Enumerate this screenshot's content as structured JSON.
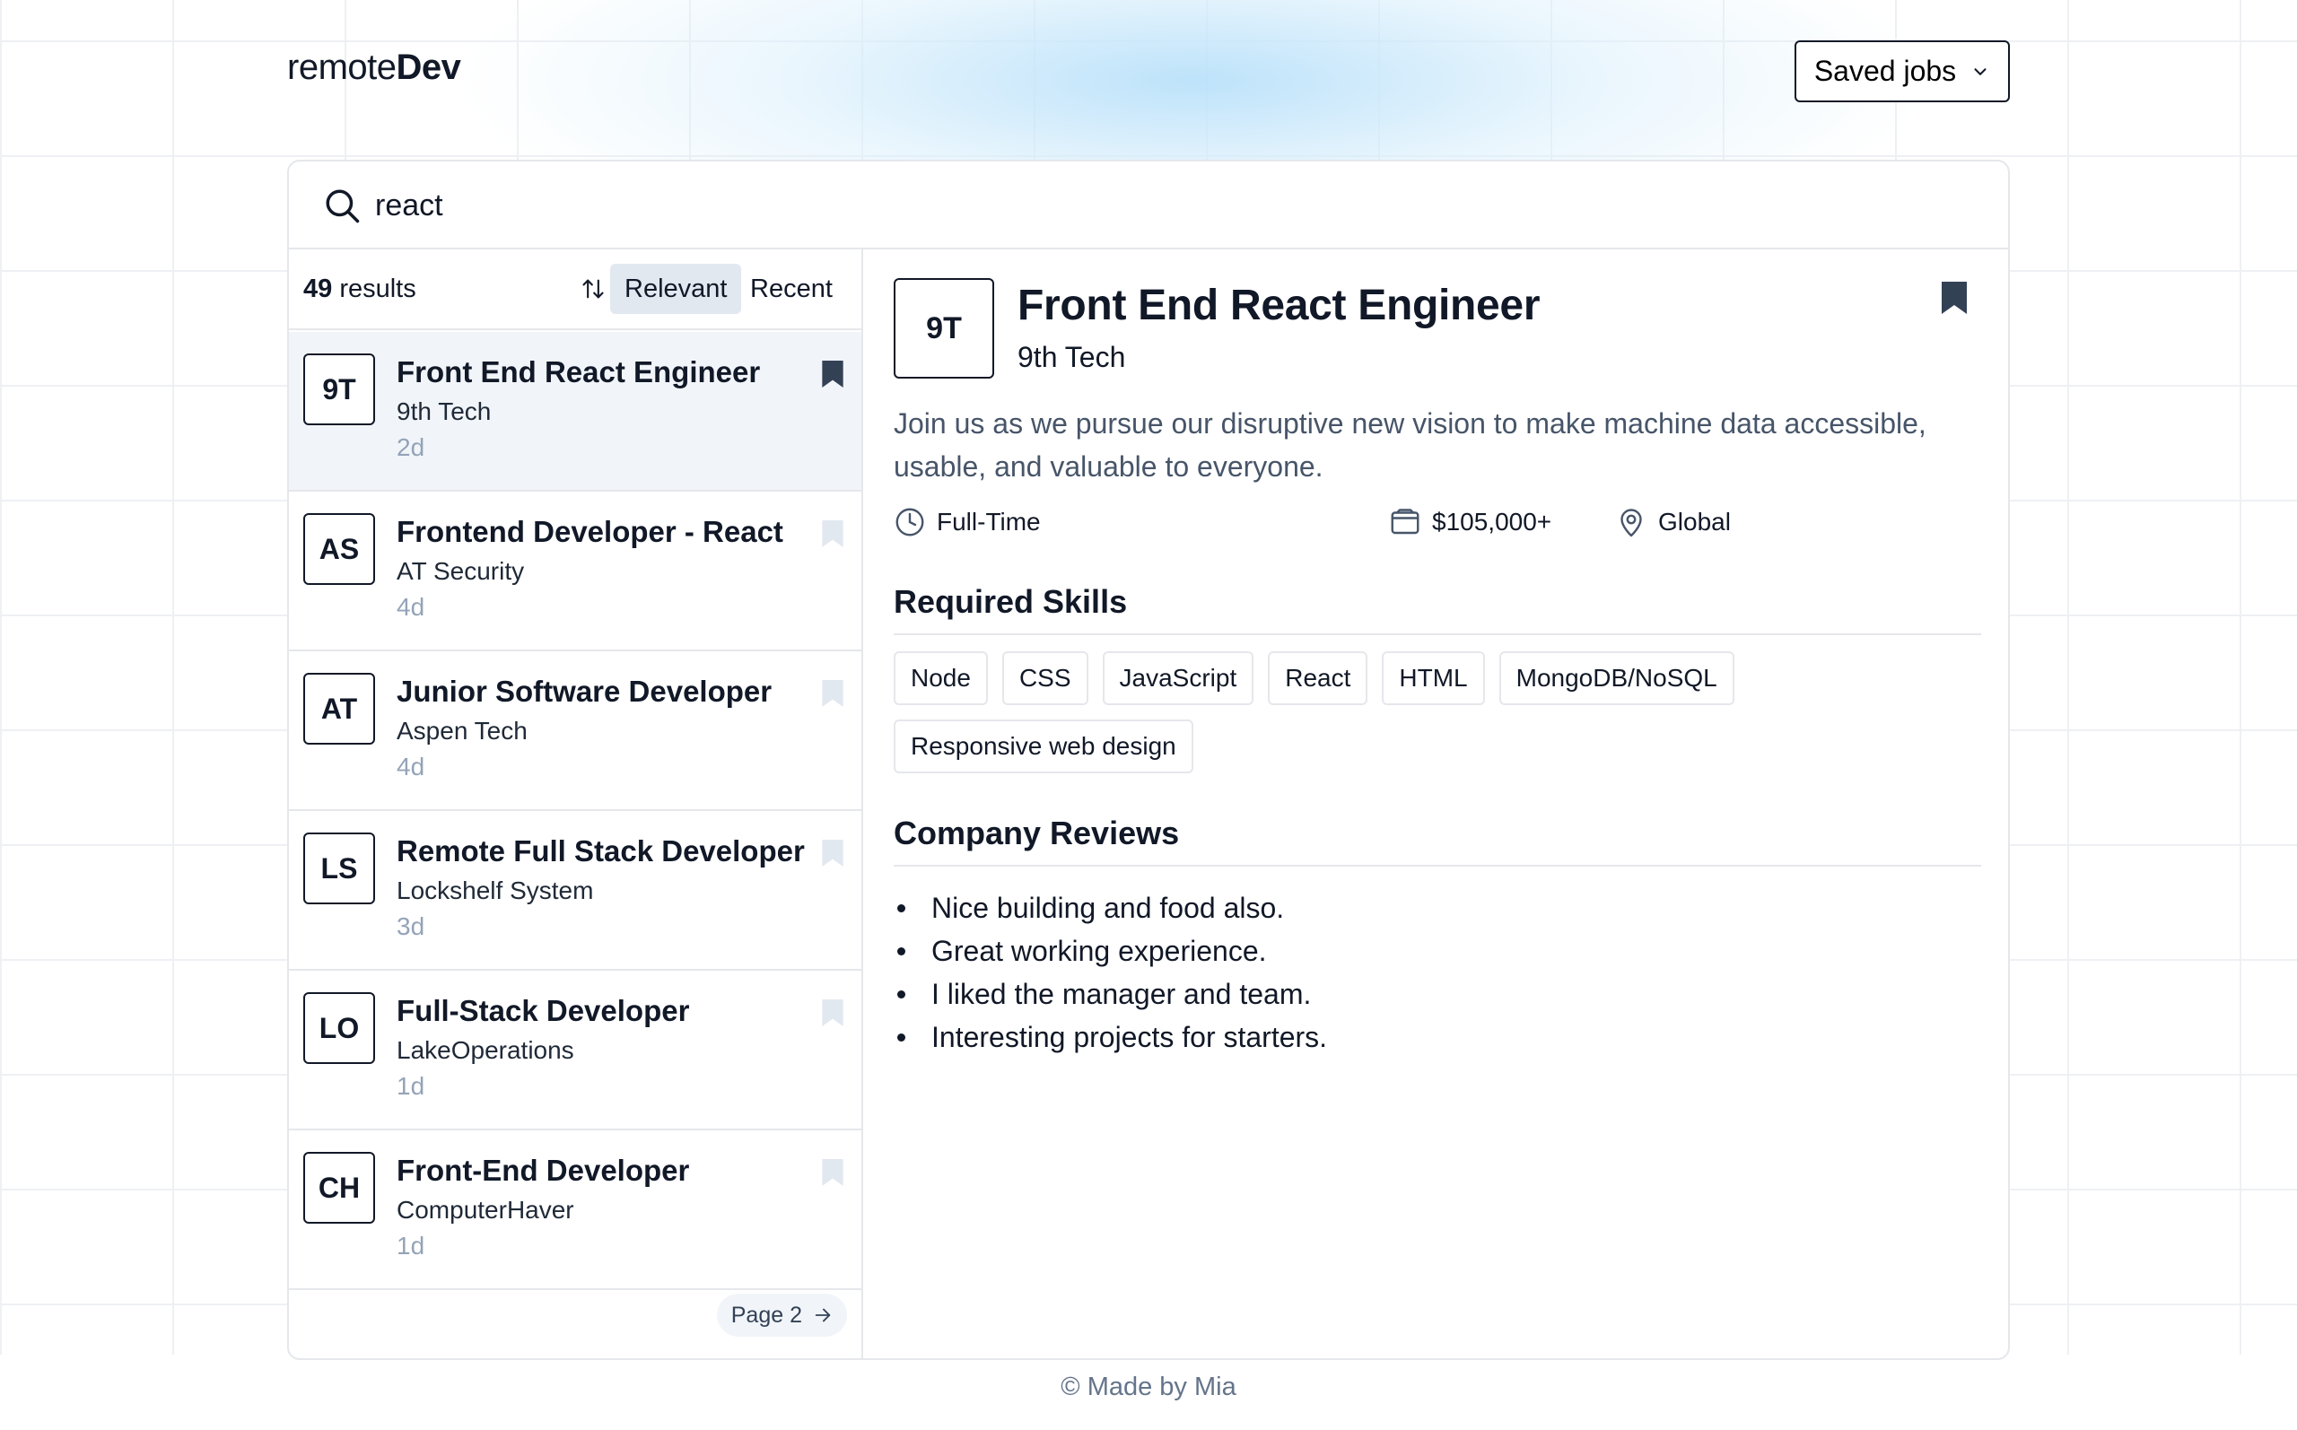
{
  "header": {
    "logo_light": "remote",
    "logo_bold": "Dev",
    "saved_jobs_label": "Saved jobs",
    "saved_jobs_icon": "chevron-down-icon"
  },
  "search": {
    "value": "react",
    "icon": "search-icon"
  },
  "results": {
    "count": "49",
    "count_suffix": " results",
    "sort_options": [
      "Relevant",
      "Recent"
    ],
    "sort_selected": "Relevant"
  },
  "jobs": [
    {
      "initials": "9T",
      "title": "Front End React Engineer",
      "company": "9th Tech",
      "age": "2d",
      "bookmarked": true
    },
    {
      "initials": "AS",
      "title": "Frontend Developer - React",
      "company": "AT Security",
      "age": "4d",
      "bookmarked": false
    },
    {
      "initials": "AT",
      "title": "Junior Software Developer",
      "company": "Aspen Tech",
      "age": "4d",
      "bookmarked": false
    },
    {
      "initials": "LS",
      "title": "Remote Full Stack Developer",
      "company": "Lockshelf System",
      "age": "3d",
      "bookmarked": false
    },
    {
      "initials": "LO",
      "title": "Full-Stack Developer",
      "company": "LakeOperations",
      "age": "1d",
      "bookmarked": false
    },
    {
      "initials": "CH",
      "title": "Front-End Developer",
      "company": "ComputerHaver",
      "age": "1d",
      "bookmarked": false
    }
  ],
  "pagination": {
    "next_label": "Page 2"
  },
  "detail": {
    "initials": "9T",
    "title": "Front End React Engineer",
    "company": "9th Tech",
    "description": "Join us as we pursue our disruptive new vision to make machine data accessible, usable, and valuable to everyone.",
    "job_type": "Full-Time",
    "salary": "$105,000+",
    "location": "Global",
    "skills_heading": "Required Skills",
    "skills": [
      "Node",
      "CSS",
      "JavaScript",
      "React",
      "HTML",
      "MongoDB/NoSQL",
      "Responsive web design"
    ],
    "reviews_heading": "Company Reviews",
    "reviews": [
      "Nice building and food also.",
      "Great working experience.",
      "I liked the manager and team.",
      "Interesting projects for starters."
    ]
  },
  "footer": {
    "text": "© Made by Mia"
  },
  "colors": {
    "text": "#111827",
    "muted": "#94a3b8",
    "selected_bg": "#f1f5f9",
    "bookmark_active": "#334155",
    "bookmark_inactive": "#e2e8f0"
  }
}
